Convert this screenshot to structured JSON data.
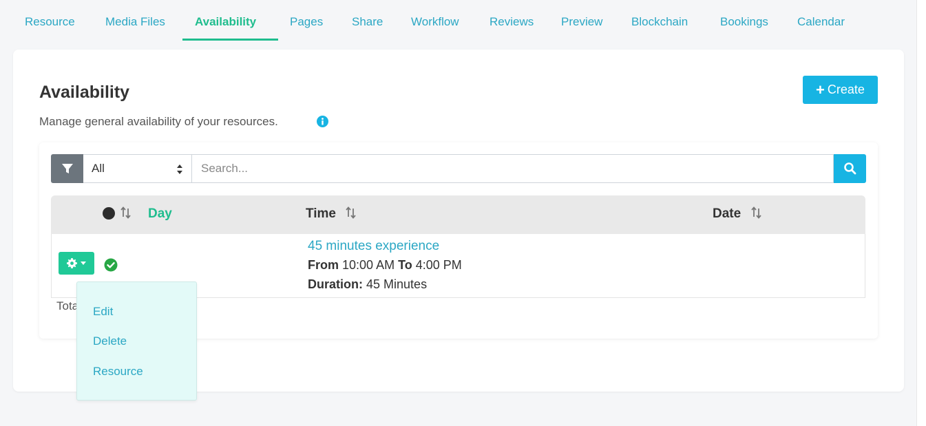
{
  "tabs": [
    {
      "label": "Resource"
    },
    {
      "label": "Media Files"
    },
    {
      "label": "Availability"
    },
    {
      "label": "Pages"
    },
    {
      "label": "Share"
    },
    {
      "label": "Workflow"
    },
    {
      "label": "Reviews"
    },
    {
      "label": "Preview"
    },
    {
      "label": "Blockchain"
    },
    {
      "label": "Bookings"
    },
    {
      "label": "Calendar"
    }
  ],
  "active_tab": "Availability",
  "page": {
    "title": "Availability",
    "subtitle": "Manage general availability of your resources.",
    "create_label": "Create"
  },
  "filter": {
    "selected": "All",
    "search_placeholder": "Search..."
  },
  "table": {
    "headers": [
      "Day",
      "Time",
      "Date"
    ],
    "rows": [
      {
        "status": "active",
        "title": "45 minutes experience",
        "from_label": "From",
        "from_time": "10:00 AM",
        "to_label": "To",
        "to_time": "4:00 PM",
        "duration_label": "Duration:",
        "duration_value": "45 Minutes"
      }
    ],
    "total_text": "Tota"
  },
  "row_menu": {
    "items": [
      "Edit",
      "Delete",
      "Resource"
    ]
  },
  "icons": {
    "info": "info-icon",
    "filter": "filter-icon",
    "search": "search-icon",
    "gear": "gear-icon",
    "check": "check-circle-icon",
    "sort": "sort-icon"
  },
  "colors": {
    "accent_teal": "#1fbd8e",
    "link_blue": "#2ba7c4",
    "primary_btn": "#17b4e3",
    "gear_btn": "#20c997",
    "dropdown_bg": "#e3faf8"
  }
}
